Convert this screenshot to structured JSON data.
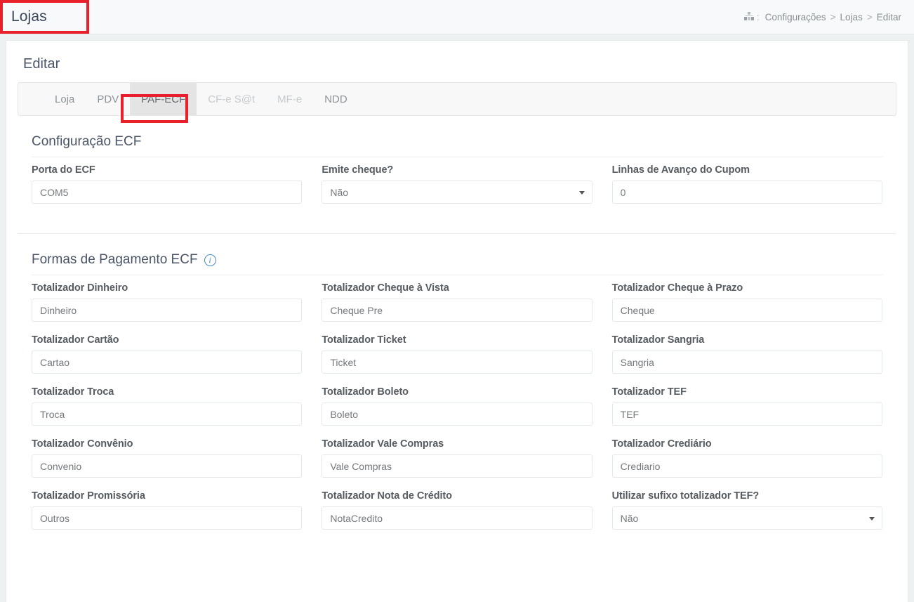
{
  "header": {
    "title": "Lojas",
    "breadcrumb": {
      "icon": "sitemap-icon",
      "colon": ":",
      "items": [
        "Configurações",
        "Lojas",
        "Editar"
      ],
      "separator": ">"
    }
  },
  "card": {
    "title": "Editar"
  },
  "tabs": [
    {
      "label": "Loja",
      "state": "normal"
    },
    {
      "label": "PDV",
      "state": "normal"
    },
    {
      "label": "PAF-ECF",
      "state": "active"
    },
    {
      "label": "CF-e S@t",
      "state": "disabled"
    },
    {
      "label": "MF-e",
      "state": "disabled"
    },
    {
      "label": "NDD",
      "state": "normal"
    }
  ],
  "sections": [
    {
      "title": "Configuração ECF",
      "info": null,
      "rows": [
        [
          {
            "label": "Porta do ECF",
            "value": "COM5",
            "type": "text"
          },
          {
            "label": "Emite cheque?",
            "value": "Não",
            "type": "select"
          },
          {
            "label": "Linhas de Avanço do Cupom",
            "value": "0",
            "type": "text"
          }
        ]
      ]
    },
    {
      "title": "Formas de Pagamento ECF",
      "info": "i",
      "rows": [
        [
          {
            "label": "Totalizador Dinheiro",
            "value": "Dinheiro",
            "type": "text"
          },
          {
            "label": "Totalizador Cheque à Vista",
            "value": "Cheque Pre",
            "type": "text"
          },
          {
            "label": "Totalizador Cheque à Prazo",
            "value": "Cheque",
            "type": "text"
          }
        ],
        [
          {
            "label": "Totalizador Cartão",
            "value": "Cartao",
            "type": "text"
          },
          {
            "label": "Totalizador Ticket",
            "value": "Ticket",
            "type": "text"
          },
          {
            "label": "Totalizador Sangria",
            "value": "Sangria",
            "type": "text"
          }
        ],
        [
          {
            "label": "Totalizador Troca",
            "value": "Troca",
            "type": "text"
          },
          {
            "label": "Totalizador Boleto",
            "value": "Boleto",
            "type": "text"
          },
          {
            "label": "Totalizador TEF",
            "value": "TEF",
            "type": "text"
          }
        ],
        [
          {
            "label": "Totalizador Convênio",
            "value": "Convenio",
            "type": "text"
          },
          {
            "label": "Totalizador Vale Compras",
            "value": "Vale Compras",
            "type": "text"
          },
          {
            "label": "Totalizador Crediário",
            "value": "Crediario",
            "type": "text"
          }
        ],
        [
          {
            "label": "Totalizador Promissória",
            "value": "Outros",
            "type": "text"
          },
          {
            "label": "Totalizador Nota de Crédito",
            "value": "NotaCredito",
            "type": "text"
          },
          {
            "label": "Utilizar sufixo totalizador TEF?",
            "value": "Não",
            "type": "select"
          }
        ]
      ]
    }
  ],
  "annotations": {
    "color": "#e8202a",
    "boxes": [
      "page-title",
      "tab-paf-ecf"
    ]
  }
}
